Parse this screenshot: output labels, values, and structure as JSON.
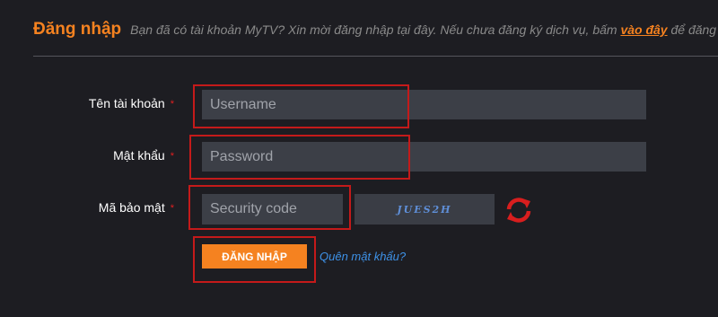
{
  "header": {
    "title": "Đăng nhập",
    "intro_prefix": "Bạn đã có tài khoản MyTV? Xin mời đăng nhập tại đây. Nếu chưa đăng ký dịch vụ, bấm ",
    "intro_link": "vào đây",
    "intro_suffix": " để đăng ký"
  },
  "form": {
    "username": {
      "label": "Tên tài khoản",
      "required_mark": "*",
      "placeholder": "Username",
      "value": ""
    },
    "password": {
      "label": "Mật khẩu",
      "required_mark": "*",
      "placeholder": "Password",
      "value": ""
    },
    "security": {
      "label": "Mã bảo mật",
      "required_mark": "*",
      "placeholder": "Security code",
      "value": ""
    },
    "captcha_text": "JUES2H",
    "refresh_icon": "refresh-icon",
    "login_label": "ĐĂNG NHẬP",
    "forgot_label": "Quên mật khẩu?"
  },
  "colors": {
    "background": "#1d1d22",
    "accent": "#f58220",
    "input_bg": "#3c3f47",
    "required": "#e02020",
    "highlight": "#c41a1a",
    "link": "#3e92e8"
  }
}
